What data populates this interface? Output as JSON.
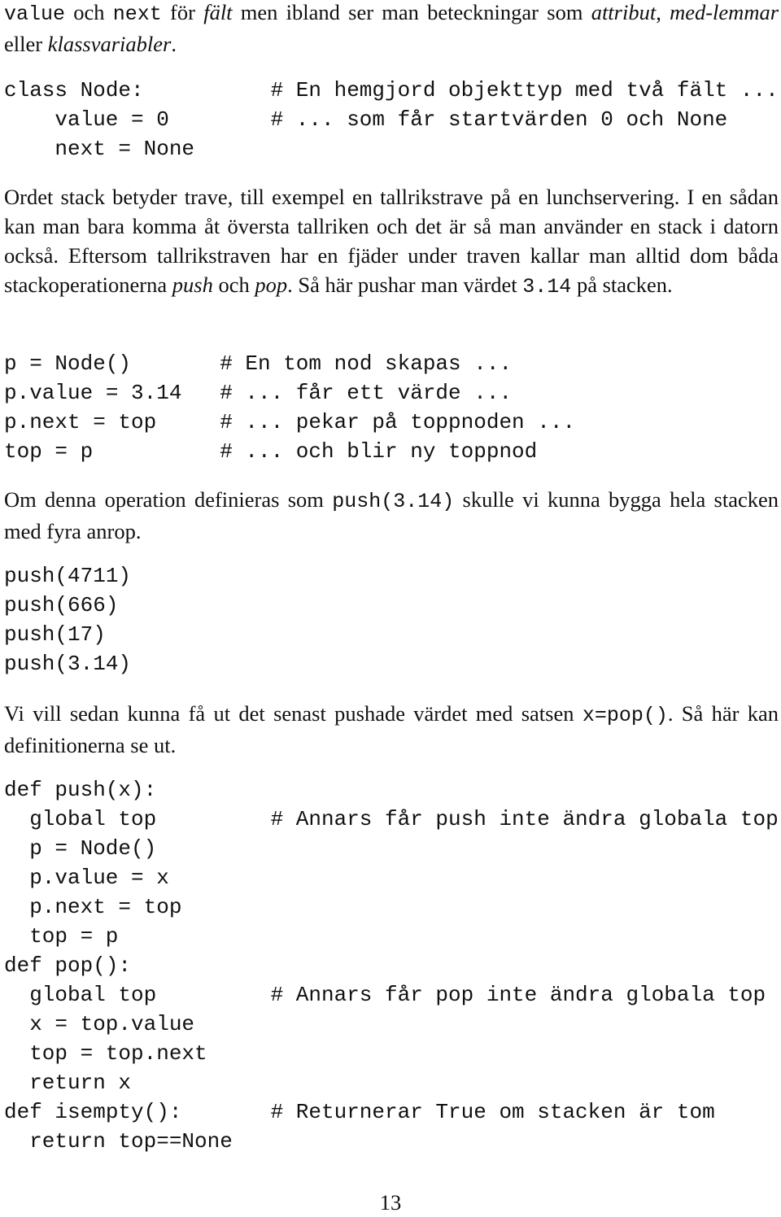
{
  "intro": {
    "parts": [
      {
        "t": "code",
        "v": "value"
      },
      {
        "t": "text",
        "v": " och "
      },
      {
        "t": "code",
        "v": "next"
      },
      {
        "t": "text",
        "v": " för "
      },
      {
        "t": "em",
        "v": "fält"
      },
      {
        "t": "text",
        "v": " men ibland ser man beteckningar som "
      },
      {
        "t": "em",
        "v": "attribut"
      },
      {
        "t": "text",
        "v": ", "
      },
      {
        "t": "em",
        "v": "med-lemmar"
      },
      {
        "t": "text",
        "v": " eller "
      },
      {
        "t": "em",
        "v": "klassvariabler"
      },
      {
        "t": "text",
        "v": "."
      }
    ]
  },
  "code_node_class": {
    "lines": [
      {
        "indent": 0,
        "code": "class Node:",
        "comment": "# En hemgjord objekttyp med två fält ..."
      },
      {
        "indent": 4,
        "code": "value = 0",
        "comment": "# ... som får startvärden 0 och None"
      },
      {
        "indent": 4,
        "code": "next = None",
        "comment": ""
      }
    ]
  },
  "stack_paragraph": {
    "parts": [
      {
        "t": "text",
        "v": "Ordet stack betyder trave, till exempel en tallrikstrave på en lunchservering. I en sådan kan man bara komma åt översta tallriken och det är så man använder en stack i datorn också. Eftersom tallrikstraven har en fjäder under traven kallar man alltid dom båda stackoperationerna "
      },
      {
        "t": "em",
        "v": "push"
      },
      {
        "t": "text",
        "v": " och "
      },
      {
        "t": "em",
        "v": "pop"
      },
      {
        "t": "text",
        "v": ". Så här pushar man värdet "
      },
      {
        "t": "code",
        "v": "3.14"
      },
      {
        "t": "text",
        "v": " på stacken."
      }
    ]
  },
  "code_push_example": {
    "lines": [
      {
        "indent": 0,
        "code": "p = Node()",
        "comment": "# En tom nod skapas ..."
      },
      {
        "indent": 0,
        "code": "p.value = 3.14",
        "comment": "# ... får ett värde ..."
      },
      {
        "indent": 0,
        "code": "p.next = top",
        "comment": "# ... pekar på toppnoden ..."
      },
      {
        "indent": 0,
        "code": "top = p",
        "comment": "# ... och blir ny toppnod"
      }
    ]
  },
  "push_paragraph": {
    "parts": [
      {
        "t": "text",
        "v": "Om denna operation definieras som "
      },
      {
        "t": "code",
        "v": "push(3.14)"
      },
      {
        "t": "text",
        "v": " skulle vi kunna bygga hela stacken med fyra anrop."
      }
    ]
  },
  "code_push_calls": {
    "lines": [
      {
        "indent": 0,
        "code": "push(4711)",
        "comment": ""
      },
      {
        "indent": 0,
        "code": "push(666)",
        "comment": ""
      },
      {
        "indent": 0,
        "code": "push(17)",
        "comment": ""
      },
      {
        "indent": 0,
        "code": "push(3.14)",
        "comment": ""
      }
    ]
  },
  "pop_paragraph": {
    "parts": [
      {
        "t": "text",
        "v": "Vi vill sedan kunna få ut det senast pushade värdet med satsen "
      },
      {
        "t": "code",
        "v": "x=pop()"
      },
      {
        "t": "text",
        "v": ". Så här kan definitionerna se ut."
      }
    ]
  },
  "code_definitions": {
    "lines": [
      {
        "indent": 0,
        "code": "def push(x):",
        "comment": ""
      },
      {
        "indent": 2,
        "code": "global top",
        "comment": "# Annars får push inte ändra globala top"
      },
      {
        "indent": 2,
        "code": "p = Node()",
        "comment": ""
      },
      {
        "indent": 2,
        "code": "p.value = x",
        "comment": ""
      },
      {
        "indent": 2,
        "code": "p.next = top",
        "comment": ""
      },
      {
        "indent": 2,
        "code": "top = p",
        "comment": ""
      },
      {
        "indent": 0,
        "code": "def pop():",
        "comment": ""
      },
      {
        "indent": 2,
        "code": "global top",
        "comment": "# Annars får pop inte ändra globala top"
      },
      {
        "indent": 2,
        "code": "x = top.value",
        "comment": ""
      },
      {
        "indent": 2,
        "code": "top = top.next",
        "comment": ""
      },
      {
        "indent": 2,
        "code": "return x",
        "comment": ""
      },
      {
        "indent": 0,
        "code": "def isempty():",
        "comment": "# Returnerar True om stacken är tom"
      },
      {
        "indent": 2,
        "code": "return top==None",
        "comment": ""
      }
    ]
  },
  "page_number": "13"
}
